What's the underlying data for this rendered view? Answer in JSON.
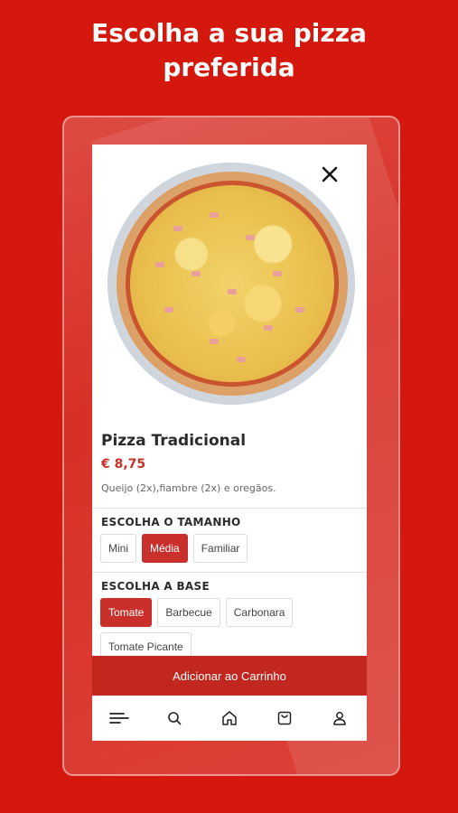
{
  "promo": {
    "title_line1": "Escolha a sua pizza",
    "title_line2": "preferida"
  },
  "product": {
    "name": "Pizza Tradicional",
    "price": "€ 8,75",
    "description": "Queijo (2x),fiambre (2x)  e oregãos."
  },
  "size_section": {
    "title": "ESCOLHA O TAMANHO",
    "options": [
      "Mini",
      "Média",
      "Familiar"
    ],
    "selected": "Média"
  },
  "base_section": {
    "title": "ESCOLHA A BASE",
    "options": [
      "Tomate",
      "Barbecue",
      "Carbonara",
      "Tomate Picante"
    ],
    "selected": "Tomate"
  },
  "cart": {
    "add_label": "Adicionar ao Carrinho"
  },
  "nav": {
    "items": [
      "menu-icon",
      "search-icon",
      "home-icon",
      "cart-icon",
      "user-icon"
    ]
  },
  "colors": {
    "background": "#d4180e",
    "accent": "#c9302c",
    "cart_button": "#c2271f"
  }
}
